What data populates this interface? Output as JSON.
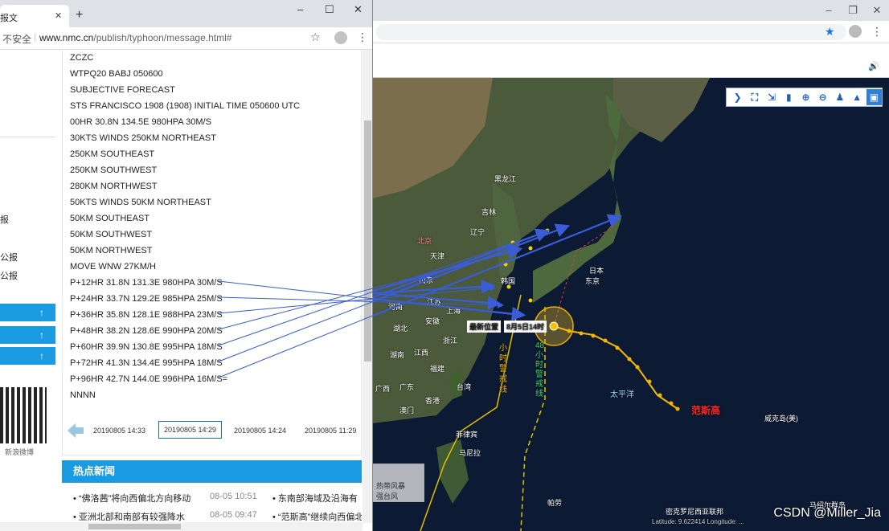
{
  "bg_browser": {
    "minimize": "–",
    "restore": "❐",
    "close": "✕",
    "star_icon": "★",
    "menu_icon": "⋮",
    "speaker_icon": "🔊"
  },
  "map": {
    "labels": {
      "heilongjiang": "黑龙江",
      "jilin": "吉林",
      "liaoning": "辽宁",
      "beijing": "北京",
      "tianjin": "天津",
      "shandong": "山东",
      "jiangsu": "江苏",
      "shanghai": "上海",
      "zhejiang": "浙江",
      "anhui": "安徽",
      "henan": "河南",
      "hubei": "湖北",
      "hunan": "湖南",
      "jiangxi": "江西",
      "fujian": "福建",
      "guangdong": "广东",
      "guangxi": "广西",
      "taiwan": "台湾",
      "hongkong": "香港",
      "macau": "澳门",
      "korea": "韩国",
      "japan": "日本",
      "tokyo": "东京",
      "philippines": "菲律宾",
      "manila": "马尼拉",
      "pacific": "太平洋",
      "wake": "威克岛(美)",
      "palau": "帕劳",
      "micronesia": "密克罗尼西亚联邦",
      "marshall": "马绍尔群岛",
      "typhoon_name": "范斯高",
      "latest_pos": "最新位置",
      "latest_time": "8月5日14时",
      "warn24": "小时警戒线",
      "warn48": "48小时警戒线"
    },
    "legend": {
      "line1": "热带风暴",
      "line2": "强台风"
    },
    "coords": "Latitude: 9.622414 Longitude: ..."
  },
  "fg_browser": {
    "tab_title": "报文",
    "tab_close": "✕",
    "new_tab": "+",
    "minimize": "–",
    "restore": "☐",
    "close": "✕",
    "insecure": "不安全",
    "url_host": "www.nmc.cn",
    "url_path": "/publish/typhoon/message.html#",
    "star_icon": "☆",
    "menu_icon": "⋮"
  },
  "left_nav": {
    "item1": "报",
    "item2": "公报",
    "item3": "公报",
    "bars": [
      "↑",
      "↑",
      "↑"
    ],
    "weibo": "新浪微博"
  },
  "message": {
    "lines": [
      "ZCZC",
      "WTPQ20 BABJ 050600",
      "SUBJECTIVE FORECAST",
      "STS FRANCISCO 1908 (1908) INITIAL TIME 050600 UTC",
      "00HR 30.8N 134.5E 980HPA 30M/S",
      "30KTS WINDS 250KM NORTHEAST",
      "250KM SOUTHEAST",
      "250KM SOUTHWEST",
      "280KM NORTHWEST",
      "50KTS WINDS 50KM NORTHEAST",
      "50KM SOUTHEAST",
      "50KM SOUTHWEST",
      "50KM NORTHWEST",
      "MOVE WNW 27KM/H",
      "P+12HR 31.8N 131.3E 980HPA 30M/S",
      "P+24HR 33.7N 129.2E 985HPA 25M/S",
      "P+36HR 35.8N 128.1E 988HPA 23M/S",
      "P+48HR 38.2N 128.6E 990HPA 20M/S",
      "P+60HR 39.9N 130.8E 995HPA 18M/S",
      "P+72HR 41.3N 134.4E 995HPA 18M/S",
      "P+96HR 42.7N 144.0E 996HPA 16M/S=",
      "NNNN"
    ],
    "timestamps": [
      "20190805 14:33",
      "20190805 14:29",
      "20190805 14:24",
      "20190805 11:29"
    ]
  },
  "hot_news": {
    "title": "热点新闻",
    "rows": [
      {
        "a": "“佛洛茜”将向西偏北方向移动",
        "date": "08-05 10:51",
        "b": "东南部海域及沿海有"
      },
      {
        "a": "亚洲北部和南部有较强降水",
        "date": "08-05 09:47",
        "b": "“范斯高”继续向西偏北"
      }
    ]
  },
  "watermark": "CSDN @Miller_Jia"
}
